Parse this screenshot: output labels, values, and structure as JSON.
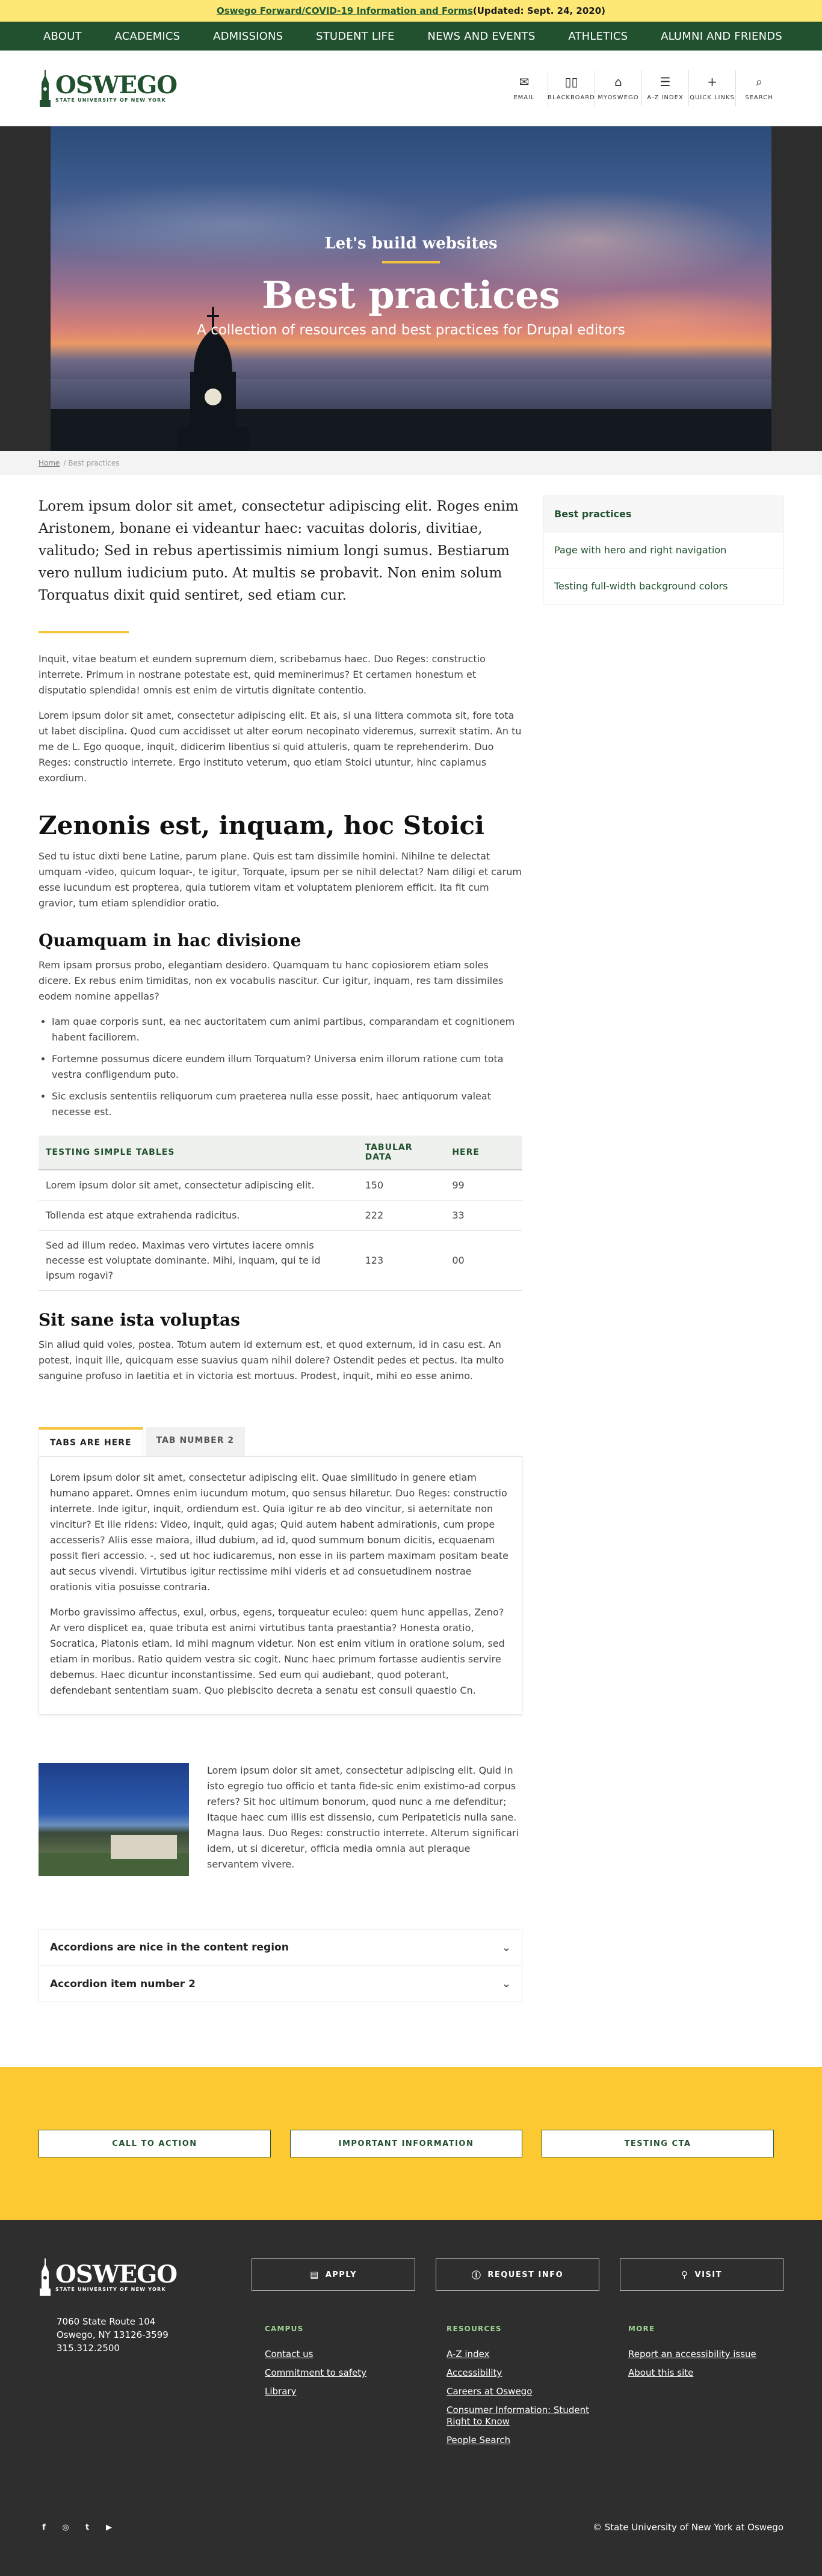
{
  "alert": {
    "link": "Oswego Forward/COVID-19 Information and Forms",
    "tail": " (Updated: Sept. 24, 2020)"
  },
  "nav": [
    "About",
    "Academics",
    "Admissions",
    "Student Life",
    "News and Events",
    "Athletics",
    "Alumni and Friends"
  ],
  "logo": {
    "name": "OSWEGO",
    "sub": "STATE UNIVERSITY OF NEW YORK"
  },
  "quick_links": [
    {
      "icon": "envelope-icon",
      "glyph": "✉",
      "label": "Email"
    },
    {
      "icon": "book-icon",
      "glyph": "▯▯",
      "label": "Blackboard"
    },
    {
      "icon": "building-icon",
      "glyph": "⌂",
      "label": "MyOswego"
    },
    {
      "icon": "list-icon",
      "glyph": "☰",
      "label": "A-Z Index"
    },
    {
      "icon": "plus-icon",
      "glyph": "+",
      "label": "Quick Links"
    },
    {
      "icon": "search-icon",
      "glyph": "⌕",
      "label": "Search"
    }
  ],
  "hero": {
    "kicker": "Let's build websites",
    "title": "Best practices",
    "subtitle": "A collection of resources and best practices for Drupal editors"
  },
  "breadcrumb": {
    "home": "Home",
    "current": "Best practices"
  },
  "sidebar": [
    "Best practices",
    "Page with hero and right navigation",
    "Testing full-width background colors"
  ],
  "content": {
    "lead": "Lorem ipsum dolor sit amet, consectetur adipiscing elit. Roges enim Aristonem, bonane ei videantur haec: vacuitas doloris, divitiae, valitudo; Sed in rebus apertissimis nimium longi sumus. Bestiarum vero nullum iudicium puto. At multis se probavit. Non enim solum Torquatus dixit quid sentiret, sed etiam cur.",
    "p1": "Inquit, vitae beatum et eundem supremum diem, scribebamus haec. Duo Reges: constructio interrete. Primum in nostrane potestate est, quid meminerimus? Et certamen honestum et disputatio splendida! omnis est enim de virtutis dignitate contentio.",
    "p2": "Lorem ipsum dolor sit amet, consectetur adipiscing elit. Et ais, si una littera commota sit, fore tota ut labet disciplina. Quod cum accidisset ut alter eorum necopinato videremus, surrexit statim. An tu me de L. Ego quoque, inquit, didicerim libentius si quid attuleris, quam te reprehenderim. Duo Reges: constructio interrete. Ergo instituto veterum, quo etiam Stoici utuntur, hinc capiamus exordium.",
    "h2": "Zenonis est, inquam, hoc Stoici",
    "p3": "Sed tu istuc dixti bene Latine, parum plane. Quis est tam dissimile homini. Nihilne te delectat umquam -video, quicum loquar-, te igitur, Torquate, ipsum per se nihil delectat? Nam diligi et carum esse iucundum est propterea, quia tutiorem vitam et voluptatem pleniorem efficit. Ita fit cum gravior, tum etiam splendidior oratio.",
    "h3a": "Quamquam in hac divisione",
    "p4": "Rem ipsam prorsus probo, elegantiam desidero. Quamquam tu hanc copiosiorem etiam soles dicere. Ex rebus enim timiditas, non ex vocabulis nascitur. Cur igitur, inquam, res tam dissimiles eodem nomine appellas?",
    "list": [
      "Iam quae corporis sunt, ea nec auctoritatem cum animi partibus, comparandam et cognitionem habent faciliorem.",
      "Fortemne possumus dicere eundem illum Torquatum? Universa enim illorum ratione cum tota vestra confligendum puto.",
      "Sic exclusis sententiis reliquorum cum praeterea nulla esse possit, haec antiquorum valeat necesse est."
    ],
    "table": {
      "headers": [
        "Testing simple tables",
        "Tabular data",
        "Here"
      ],
      "rows": [
        [
          "Lorem ipsum dolor sit amet, consectetur adipiscing elit.",
          "150",
          "99"
        ],
        [
          "Tollenda est atque extrahenda radicitus.",
          "222",
          "33"
        ],
        [
          "Sed ad illum redeo. Maximas vero virtutes iacere omnis necesse est voluptate dominante. Mihi, inquam, qui te id ipsum rogavi?",
          "123",
          "00"
        ]
      ]
    },
    "h3b": "Sit sane ista voluptas",
    "p5": "Sin aliud quid voles, postea. Totum autem id externum est, et quod externum, id in casu est. An potest, inquit ille, quicquam esse suavius quam nihil dolere? Ostendit pedes et pectus. Ita multo sanguine profuso in laetitia et in victoria est mortuus. Prodest, inquit, mihi eo esse animo."
  },
  "tabs": {
    "labels": [
      "Tabs are here",
      "Tab number 2"
    ],
    "p1": "Lorem ipsum dolor sit amet, consectetur adipiscing elit. Quae similitudo in genere etiam humano apparet. Omnes enim iucundum motum, quo sensus hilaretur. Duo Reges: constructio interrete. Inde igitur, inquit, ordiendum est. Quia igitur re ab deo vincitur, si aeternitate non vincitur? Et ille ridens: Video, inquit, quid agas; Quid autem habent admirationis, cum prope accesseris? Aliis esse maiora, illud dubium, ad id, quod summum bonum dicitis, ecquaenam possit fieri accessio. -, sed ut hoc iudicaremus, non esse in iis partem maximam positam beate aut secus vivendi. Virtutibus igitur rectissime mihi videris et ad consuetudinem nostrae orationis vitia posuisse contraria.",
    "p2": "Morbo gravissimo affectus, exul, orbus, egens, torqueatur eculeo: quem hunc appellas, Zeno? Ar vero displicet ea, quae tributa est animi virtutibus tanta praestantia? Honesta oratio, Socratica, Platonis etiam. Id mihi magnum videtur. Non est enim vitium in oratione solum, sed etiam in moribus. Ratio quidem vestra sic cogit. Nunc haec primum fortasse audientis servire debemus. Haec dicuntur inconstantissime. Sed eum qui audiebant, quod poterant, defendebant sententiam suam. Quo plebiscito decreta a senatu est consuli quaestio Cn."
  },
  "media_text": "Lorem ipsum dolor sit amet, consectetur adipiscing elit. Quid in isto egregio tuo officio et tanta fide-sic enim existimo-ad corpus refers? Sit hoc ultimum bonorum, quod nunc a me defenditur; Itaque haec cum illis est dissensio, cum Peripateticis nulla sane. Magna laus. Duo Reges: constructio interrete. Alterum significari idem, ut si diceretur, officia media omnia aut pleraque servantem vivere.",
  "accordion": [
    "Accordions are nice in the content region",
    "Accordion item number 2"
  ],
  "ctas": [
    "Call to Action",
    "Important Information",
    "Testing CTA"
  ],
  "footer": {
    "buttons": [
      {
        "icon": "clipboard-icon",
        "glyph": "▤",
        "label": "Apply"
      },
      {
        "icon": "info-icon",
        "glyph": "ⓘ",
        "label": "Request Info"
      },
      {
        "icon": "map-pin-icon",
        "glyph": "⚲",
        "label": "Visit"
      }
    ],
    "address": [
      "7060 State Route 104",
      "Oswego, NY 13126-3599",
      "315.312.2500"
    ],
    "columns": [
      {
        "title": "Campus",
        "links": [
          "Contact us",
          "Commitment to safety",
          "Library"
        ]
      },
      {
        "title": "Resources",
        "links": [
          "A-Z index",
          "Accessibility",
          "Careers at Oswego",
          "Consumer Information: Student Right to Know",
          "People Search"
        ]
      },
      {
        "title": "More",
        "links": [
          "Report an accessibility issue",
          "About this site"
        ]
      }
    ],
    "socials": [
      {
        "icon": "facebook-icon",
        "glyph": "f"
      },
      {
        "icon": "instagram-icon",
        "glyph": "◎"
      },
      {
        "icon": "twitter-icon",
        "glyph": "t"
      },
      {
        "icon": "youtube-icon",
        "glyph": "▶"
      }
    ],
    "copyright": "© State University of New York at Oswego"
  },
  "colors": {
    "brand_green": "#21512f",
    "gold": "#f6c33d",
    "cta_band": "#fcc933",
    "alert": "#fde876",
    "footer": "#2e2e2e"
  }
}
